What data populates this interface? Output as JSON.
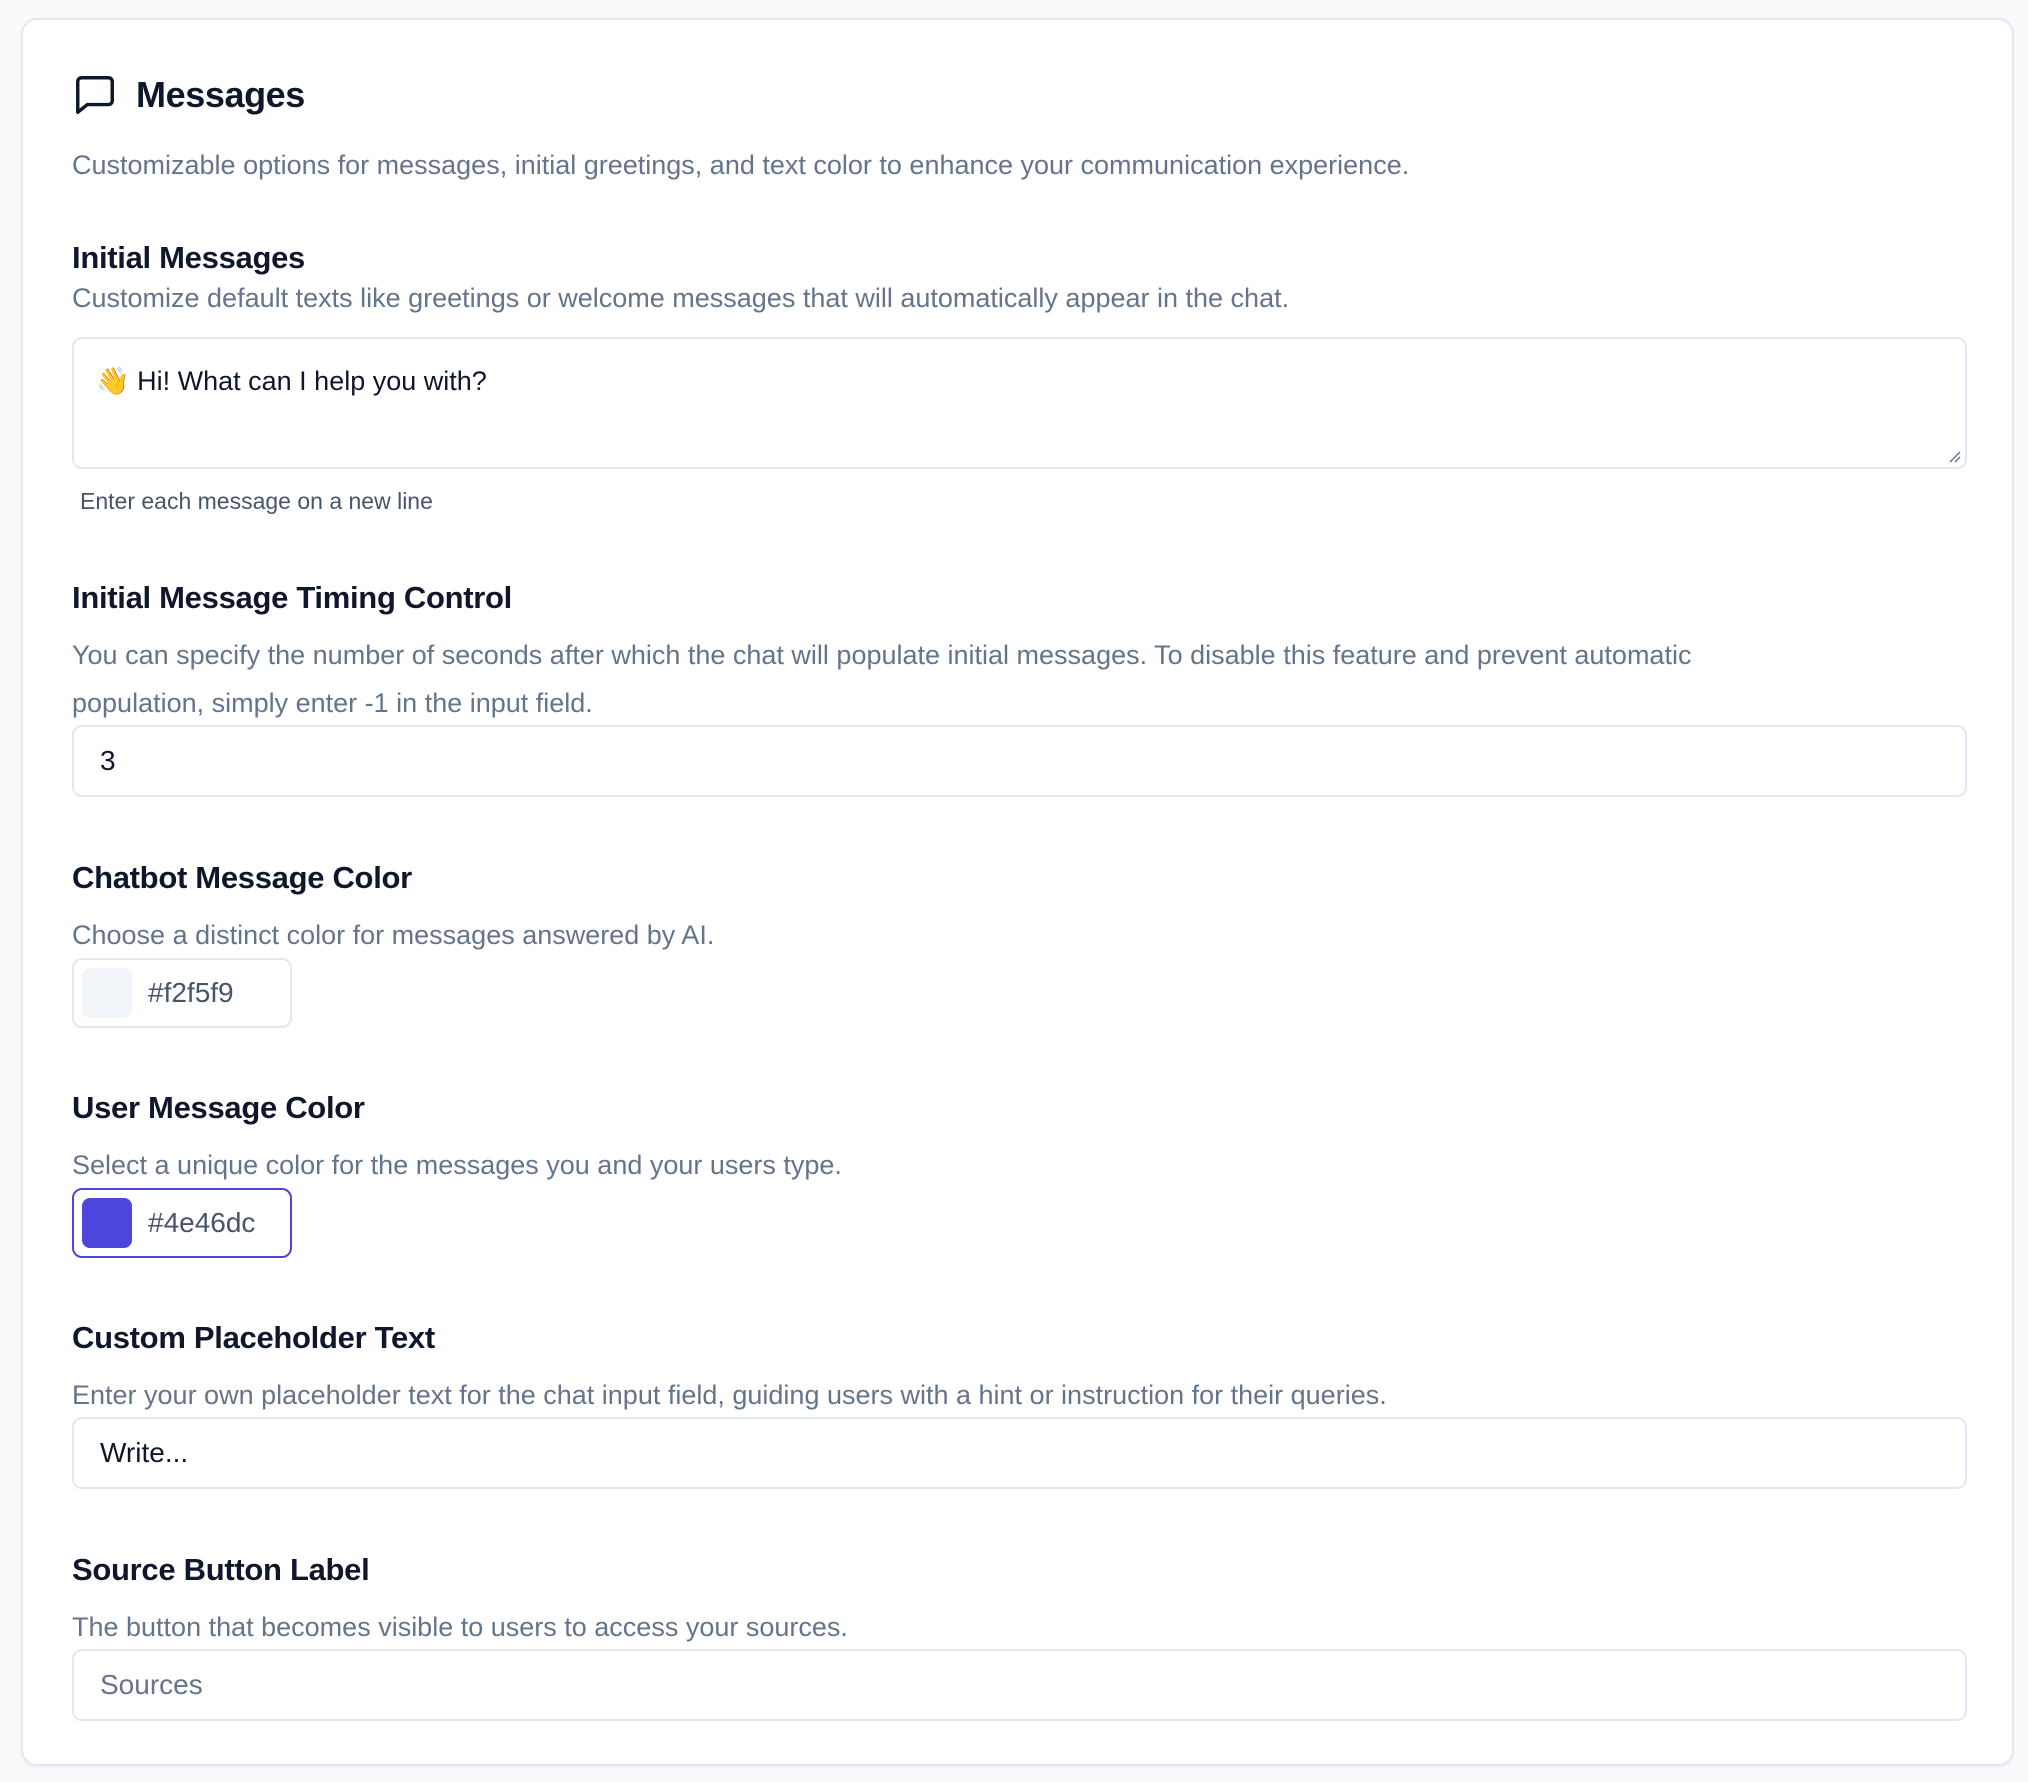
{
  "header": {
    "title": "Messages",
    "icon": "message-square-icon",
    "description": "Customizable options for messages, initial greetings, and text color to enhance your communication experience."
  },
  "initial_messages": {
    "title": "Initial Messages",
    "description": "Customize default texts like greetings or welcome messages that will automatically appear in the chat.",
    "value": "👋 Hi! What can I help you with?",
    "hint": "Enter each message on a new line"
  },
  "timing": {
    "title": "Initial Message Timing Control",
    "description_line1": "You can specify the number of seconds after which the chat will populate initial messages. To disable this feature and prevent automatic",
    "description_line2": "population, simply enter -1 in the input field.",
    "value": "3"
  },
  "chatbot_color": {
    "title": "Chatbot Message Color",
    "description": "Choose a distinct color for messages answered by AI.",
    "value": "#f2f5f9"
  },
  "user_color": {
    "title": "User Message Color",
    "description": "Select a unique color for the messages you and your users type.",
    "value": "#4e46dc"
  },
  "placeholder": {
    "title": "Custom Placeholder Text",
    "description": "Enter your own placeholder text for the chat input field, guiding users with a hint or instruction for their queries.",
    "value": "Write..."
  },
  "source_button": {
    "title": "Source Button Label",
    "description": "The button that becomes visible to users to access your sources.",
    "value": "Sources"
  },
  "colors": {
    "accent": "#4e46dc",
    "muted_text": "#64748b",
    "border": "#e2e8f0"
  }
}
